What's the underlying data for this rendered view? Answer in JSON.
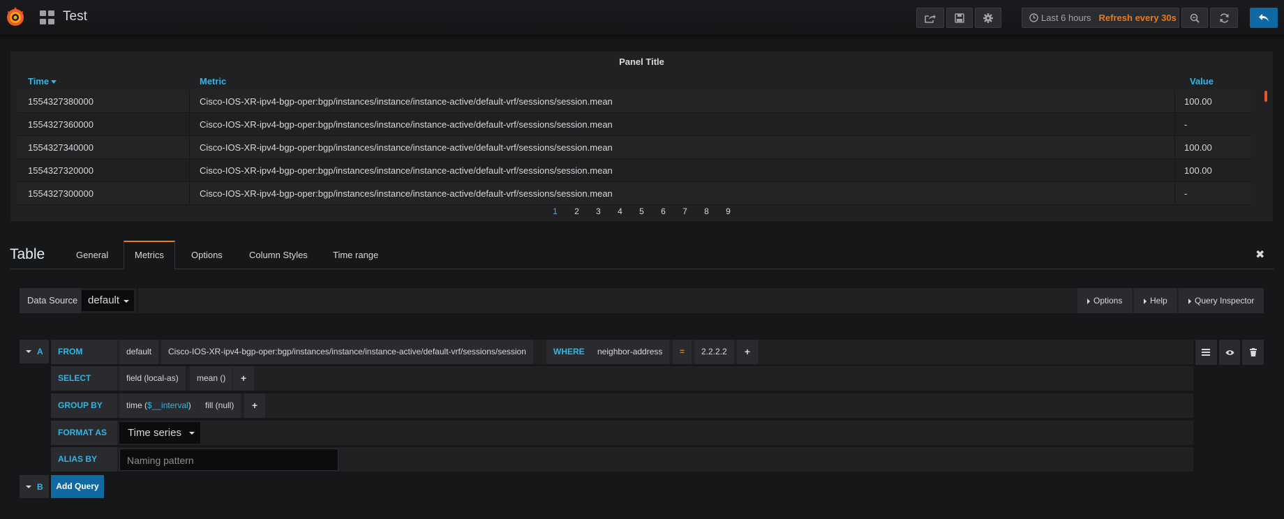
{
  "navbar": {
    "dashboard_title": "Test",
    "time_range": "Last 6 hours",
    "refresh": "Refresh every 30s"
  },
  "panel": {
    "title": "Panel Title",
    "columns": {
      "time": "Time",
      "metric": "Metric",
      "value": "Value"
    },
    "rows": [
      {
        "time": "1554327380000",
        "metric": "Cisco-IOS-XR-ipv4-bgp-oper:bgp/instances/instance/instance-active/default-vrf/sessions/session.mean",
        "value": "100.00"
      },
      {
        "time": "1554327360000",
        "metric": "Cisco-IOS-XR-ipv4-bgp-oper:bgp/instances/instance/instance-active/default-vrf/sessions/session.mean",
        "value": "-"
      },
      {
        "time": "1554327340000",
        "metric": "Cisco-IOS-XR-ipv4-bgp-oper:bgp/instances/instance/instance-active/default-vrf/sessions/session.mean",
        "value": "100.00"
      },
      {
        "time": "1554327320000",
        "metric": "Cisco-IOS-XR-ipv4-bgp-oper:bgp/instances/instance/instance-active/default-vrf/sessions/session.mean",
        "value": "100.00"
      },
      {
        "time": "1554327300000",
        "metric": "Cisco-IOS-XR-ipv4-bgp-oper:bgp/instances/instance/instance-active/default-vrf/sessions/session.mean",
        "value": "-"
      }
    ],
    "pages": [
      "1",
      "2",
      "3",
      "4",
      "5",
      "6",
      "7",
      "8",
      "9"
    ],
    "current_page": "1"
  },
  "editor": {
    "title": "Table",
    "tabs": [
      "General",
      "Metrics",
      "Options",
      "Column Styles",
      "Time range"
    ],
    "active_tab": "Metrics"
  },
  "datasource": {
    "label": "Data Source",
    "value": "default",
    "buttons": {
      "options": "Options",
      "help": "Help",
      "inspector": "Query Inspector"
    }
  },
  "query_a": {
    "ref": "A",
    "from_label": "FROM",
    "policy": "default",
    "measurement": "Cisco-IOS-XR-ipv4-bgp-oper:bgp/instances/instance/instance-active/default-vrf/sessions/session",
    "where_label": "WHERE",
    "where_key": "neighbor-address",
    "where_op": "=",
    "where_value": "2.2.2.2",
    "select_label": "SELECT",
    "select_field": "field (local-as)",
    "select_fn": "mean ()",
    "group_label": "GROUP BY",
    "group_time_prefix": "time (",
    "group_time_var": "$__interval",
    "group_time_suffix": ")",
    "group_fill": "fill (null)",
    "format_label": "FORMAT AS",
    "format_value": "Time series",
    "alias_label": "ALIAS BY",
    "alias_placeholder": "Naming pattern"
  },
  "query_b": {
    "ref": "B",
    "add_label": "Add Query"
  },
  "plus": "+",
  "colors": {
    "accent_blue": "#33b5e5",
    "accent_orange": "#eb7b18",
    "primary_btn": "#0f6aa3",
    "background": "#161719"
  }
}
